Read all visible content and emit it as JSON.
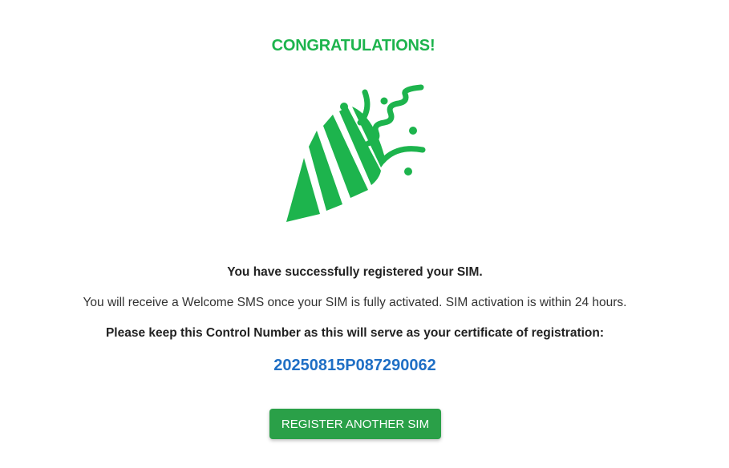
{
  "header": {
    "title": "CONGRATULATIONS!"
  },
  "illustration": {
    "icon": "party-popper-icon",
    "color": "#1db44d"
  },
  "message": {
    "success": "You have successfully registered your SIM.",
    "info": "You will receive a Welcome SMS once your SIM is fully activated. SIM activation is within 24 hours.",
    "keep_notice": "Please keep this Control Number as this will serve as your certificate of registration:",
    "control_number": "20250815P087290062"
  },
  "actions": {
    "register_another_label": "REGISTER ANOTHER SIM"
  },
  "colors": {
    "accent_green": "#1db44d",
    "button_green": "#2aa048",
    "control_number_blue": "#1f6fc5"
  }
}
